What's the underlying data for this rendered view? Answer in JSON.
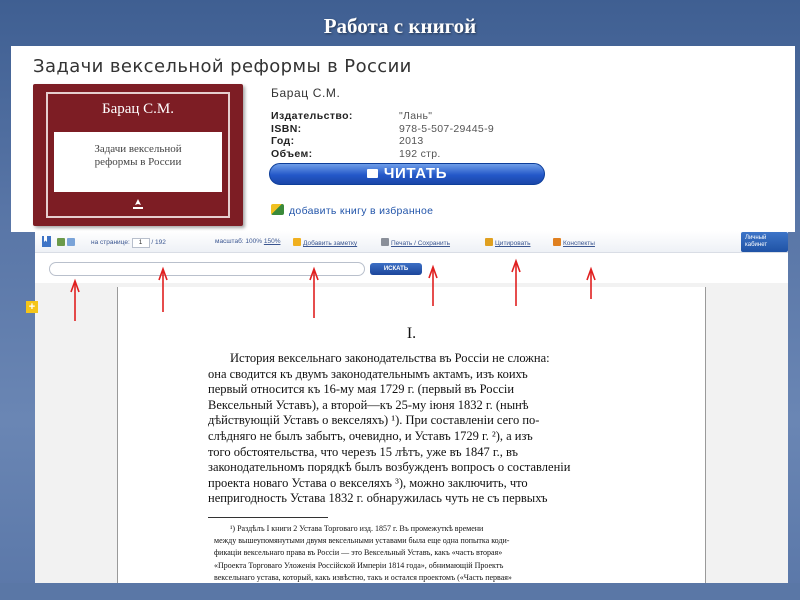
{
  "slide": {
    "title": "Работа с книгой"
  },
  "book": {
    "title": "Задачи вексельной реформы в России",
    "cover": {
      "author": "Барац С.М.",
      "title_lines": [
        "Задачи вексельной",
        "реформы в России"
      ]
    },
    "author": "Барац С.М.",
    "meta": [
      {
        "label": "Издательство:",
        "value": "\"Лань\""
      },
      {
        "label": "ISBN:",
        "value": "978-5-507-29445-9"
      },
      {
        "label": "Год:",
        "value": "2013"
      },
      {
        "label": "Объем:",
        "value": "192 стр."
      }
    ],
    "read_button": "ЧИТАТЬ",
    "favorite_link": "добавить книгу в избранное"
  },
  "reader": {
    "toolbar": {
      "page_label": "на странице:",
      "page_value": "1",
      "page_total": "/ 192",
      "zoom_label": "масштаб:",
      "zoom_100": "100%",
      "zoom_150": "150%",
      "add_note": "Добавить заметку",
      "print_save": "Печать / Сохранить",
      "quote": "Цитировать",
      "notes": "Конспекты",
      "cabinet_line1": "Личный",
      "cabinet_line2": "кабинет"
    },
    "search": {
      "button": "ИСКАТЬ",
      "placeholder": ""
    },
    "page": {
      "chapter": "I.",
      "paragraph_lines": [
        "История вексельнаго законодательства въ Россіи не сложна:",
        "она сводится къ двумъ законодательнымъ актамъ, изъ коихъ",
        "первый относится къ 16-му мая 1729 г. (первый въ Россіи",
        "Вексельный Уставъ), а второй—къ 25-му іюня 1832 г. (нынѣ",
        "дѣйствующій Уставъ о векселяхъ) ¹). При составленіи сего по-",
        "слѣдняго не былъ забытъ, очевидно, и Уставъ 1729 г. ²), а изъ",
        "того обстоятельства, что черезъ 15 лѣтъ, уже въ 1847 г., въ",
        "законодательномъ порядкѣ былъ возбужденъ вопросъ о составленіи",
        "проекта новаго Устава о векселяхъ ³), можно заключить, что",
        "непригодность Устава 1832 г. обнаружилась чуть не съ первыхъ"
      ],
      "footnote_lines": [
        "¹) Раздѣлъ I книги 2 Устава Торговаго изд. 1857 г. Въ промежуткѣ времени",
        "между вышеупомянутыми двумя вексельными уставами была еще одна попытка коди-",
        "фикаціи вексельнаго права въ Россіи — это Вексельный Уставъ, какъ «часть вторая»",
        "«Проекта Торговаго Уложенія Россійской Имперіи 1814 года», обнимающій Проектъ",
        "вексельнаго устава, который, какъ извѣстно, такъ и остался проектомъ («Часть первая»"
      ]
    }
  },
  "colors": {
    "background": "#5875a6",
    "cover": "#7d1d24",
    "button_blue": "#2458c9",
    "arrow_red": "#e02020",
    "link_blue": "#2255aa"
  },
  "icons": [
    "bookmark-icon",
    "book-icon",
    "favorite-icon",
    "note-icon",
    "print-icon",
    "quote-icon",
    "notes-icon",
    "plus-icon",
    "arrow-up-icon"
  ]
}
